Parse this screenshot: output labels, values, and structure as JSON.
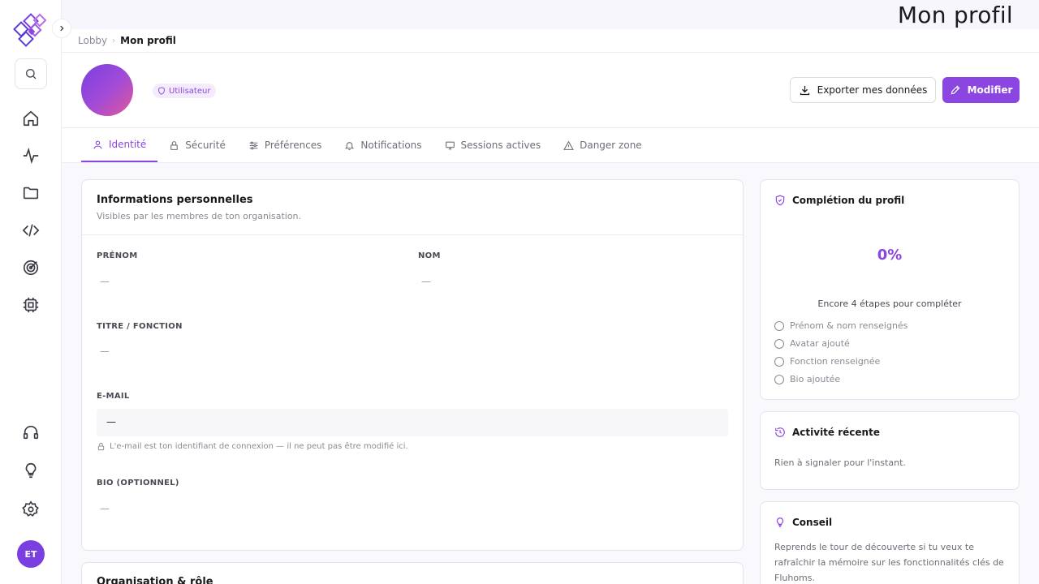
{
  "header": {
    "title": "Mon profil"
  },
  "breadcrumb": {
    "items": [
      "Lobby",
      "Mon profil"
    ]
  },
  "user": {
    "initials": "ET",
    "role": "Utilisateur"
  },
  "actions": {
    "export_label": "Exporter mes données",
    "edit_label": "Modifier"
  },
  "tabs": [
    {
      "label": "Identité",
      "icon": "user-icon"
    },
    {
      "label": "Sécurité",
      "icon": "lock-icon"
    },
    {
      "label": "Préférences",
      "icon": "sliders-icon"
    },
    {
      "label": "Notifications",
      "icon": "bell-icon"
    },
    {
      "label": "Sessions actives",
      "icon": "monitor-icon"
    },
    {
      "label": "Danger zone",
      "icon": "warning-icon"
    }
  ],
  "personal": {
    "title": "Informations personnelles",
    "subtitle": "Visibles par les membres de ton organisation.",
    "first_name": {
      "label": "PRÉNOM",
      "value": "—"
    },
    "last_name": {
      "label": "NOM",
      "value": "—"
    },
    "job_title": {
      "label": "TITRE / FONCTION",
      "value": "—"
    },
    "email": {
      "label": "E-MAIL",
      "value": "—",
      "note": "L'e-mail est ton identifiant de connexion — il ne peut pas être modifié ici."
    },
    "bio": {
      "label": "BIO (OPTIONNEL)",
      "value": "—"
    }
  },
  "organisation": {
    "title": "Organisation & rôle"
  },
  "completion": {
    "title": "Complétion du profil",
    "percent_label": "0%",
    "percent": 0,
    "remaining": "Encore 4 étapes pour compléter",
    "steps": [
      "Prénom & nom renseignés",
      "Avatar ajouté",
      "Fonction renseignée",
      "Bio ajoutée"
    ]
  },
  "activity": {
    "title": "Activité récente",
    "text": "Rien à signaler pour l'instant."
  },
  "tip": {
    "title": "Conseil",
    "text": "Reprends le tour de découverte si tu veux te rafraîchir la mémoire sur les fonctionnalités clés de Fluhoms."
  },
  "sidebar": {
    "icons": [
      "home-icon",
      "activity-icon",
      "folder-icon",
      "code-icon",
      "target-icon",
      "chip-icon",
      "headset-icon",
      "lightbulb-icon",
      "settings-icon"
    ]
  },
  "colors": {
    "accent": "#8b45e0",
    "badge_bg": "#f4ecfd",
    "band_bg": "#f9f8fc"
  }
}
